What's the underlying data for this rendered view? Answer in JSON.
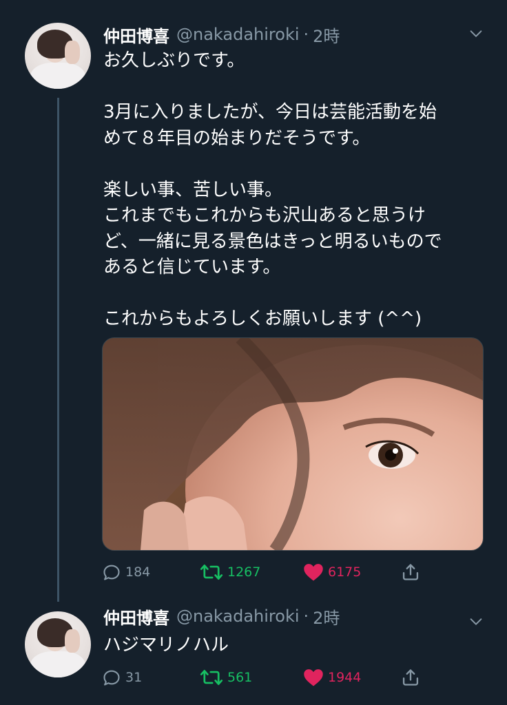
{
  "tweets": [
    {
      "author_name": "仲田博喜",
      "handle": "@nakadahiroki",
      "separator": "·",
      "time": "2時",
      "lines": [
        "お久しぶりです。",
        "",
        "3月に入りましたが、今日は芸能活動を始",
        "めて８年目の始まりだそうです。",
        "",
        "楽しい事、苦しい事。",
        "これまでもこれからも沢山あると思うけ",
        "ど、一緒に見る景色はきっと明るいもので",
        "あると信じています。",
        "",
        "これからもよろしくお願いします (^^)"
      ],
      "replies": "184",
      "retweets": "1267",
      "likes": "6175"
    },
    {
      "author_name": "仲田博喜",
      "handle": "@nakadahiroki",
      "separator": "·",
      "time": "2時",
      "lines": [
        "ハジマリノハル"
      ],
      "replies": "31",
      "retweets": "561",
      "likes": "1944"
    }
  ],
  "colors": {
    "background": "#15202b",
    "secondary_text": "#8899a6",
    "retweet": "#17bf63",
    "like": "#e0245e"
  },
  "icons": [
    "chevron-down-icon",
    "reply-icon",
    "retweet-icon",
    "heart-icon",
    "share-icon"
  ]
}
